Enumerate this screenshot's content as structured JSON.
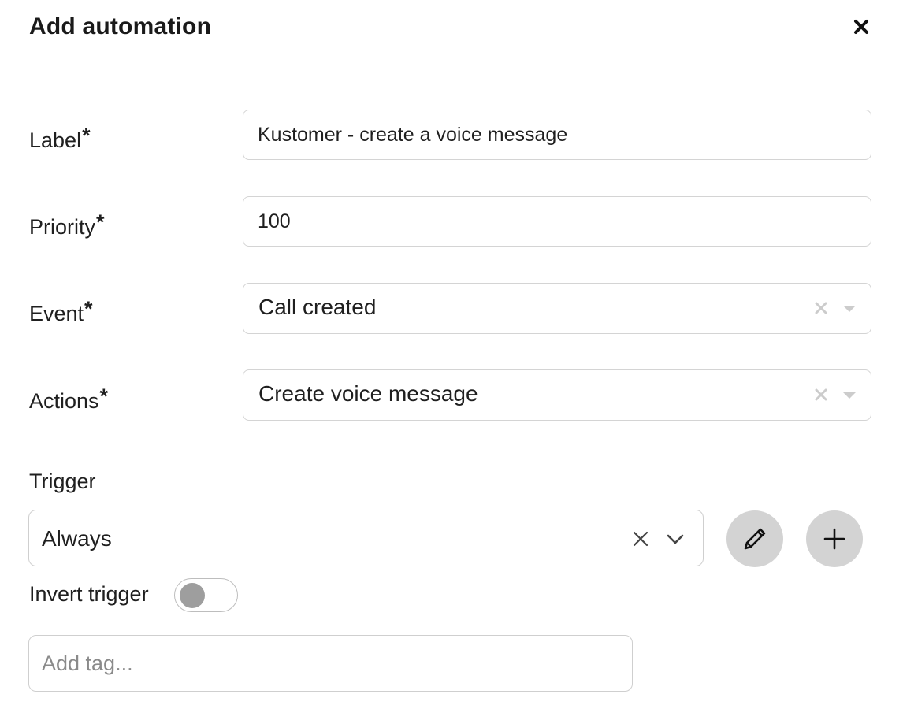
{
  "dialog": {
    "title": "Add automation"
  },
  "fields": {
    "label": {
      "label": "Label",
      "required_mark": "*",
      "value": "Kustomer - create a voice message"
    },
    "priority": {
      "label": "Priority",
      "required_mark": "*",
      "value": "100"
    },
    "event": {
      "label": "Event",
      "required_mark": "*",
      "value": "Call created"
    },
    "actions": {
      "label": "Actions",
      "required_mark": "*",
      "value": "Create voice message"
    }
  },
  "trigger": {
    "label": "Trigger",
    "value": "Always",
    "invert_label": "Invert trigger",
    "invert_on": false
  },
  "tags": {
    "placeholder": "Add tag..."
  },
  "icons": {
    "close": "close-icon",
    "clear": "clear-icon",
    "caret": "caret-down-icon",
    "chevron": "chevron-down-icon",
    "edit": "pencil-icon",
    "add": "plus-icon"
  },
  "colors": {
    "round_button_bg": "#d3d3d3",
    "toggle_knob": "#9e9e9e",
    "border": "#d4d4d4"
  }
}
